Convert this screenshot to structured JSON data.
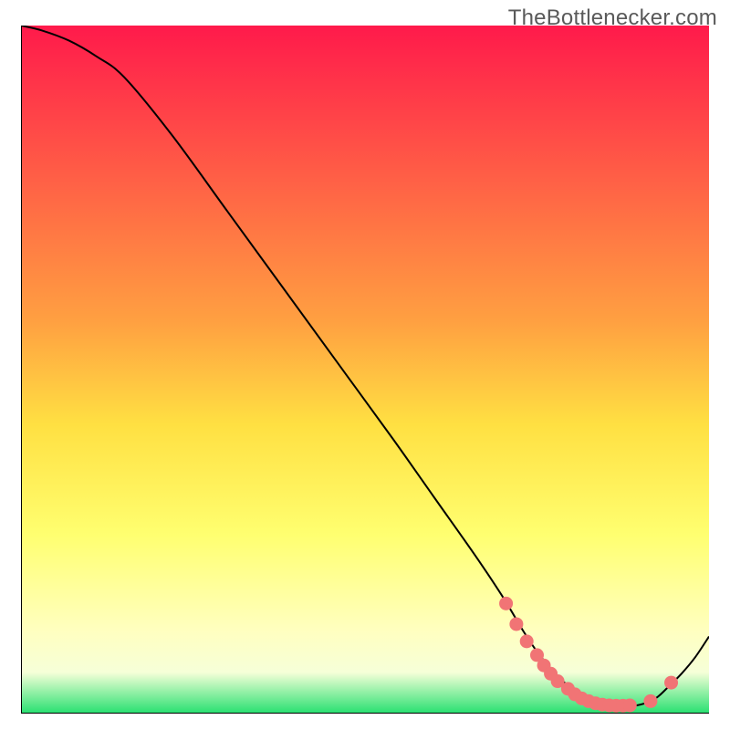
{
  "watermark": "TheBottlenecker.com",
  "chart_data": {
    "type": "line",
    "title": "",
    "xlabel": "",
    "ylabel": "",
    "xlim": [
      0,
      100
    ],
    "ylim": [
      0,
      100
    ],
    "gradient_stops": [
      {
        "offset": 0,
        "color": "#ff1a4b"
      },
      {
        "offset": 43,
        "color": "#ffa041"
      },
      {
        "offset": 58,
        "color": "#ffe042"
      },
      {
        "offset": 74,
        "color": "#ffff70"
      },
      {
        "offset": 88,
        "color": "#ffffc0"
      },
      {
        "offset": 94,
        "color": "#f6ffd8"
      },
      {
        "offset": 100,
        "color": "#27e070"
      }
    ],
    "curve": {
      "x": [
        0,
        3,
        7,
        11,
        15,
        22,
        30,
        38,
        46,
        54,
        60,
        66,
        70,
        73,
        75,
        77,
        79,
        81,
        83,
        85,
        87,
        89,
        91,
        92.5,
        94,
        96,
        98,
        100
      ],
      "y": [
        100,
        99.3,
        97.8,
        95.5,
        92.5,
        84,
        73,
        62,
        51,
        40,
        31.5,
        23,
        17,
        12,
        9,
        6.5,
        4.5,
        3,
        2,
        1.3,
        1,
        1.1,
        1.6,
        2.4,
        3.8,
        5.8,
        8.2,
        11.2
      ]
    },
    "markers": {
      "x": [
        70.5,
        72,
        73.5,
        75,
        76,
        77,
        78,
        79.5,
        80.5,
        81.5,
        82.5,
        83.5,
        84.5,
        85.5,
        86.5,
        87.5,
        88.5,
        91.5,
        94.5
      ],
      "y": [
        16,
        13,
        10.5,
        8.5,
        7,
        5.8,
        4.7,
        3.6,
        2.8,
        2.2,
        1.8,
        1.5,
        1.3,
        1.2,
        1.15,
        1.15,
        1.2,
        1.8,
        4.5
      ],
      "color": "#f17475",
      "radius": 7.5
    },
    "axis_color": "#000000",
    "curve_color": "#000000"
  }
}
